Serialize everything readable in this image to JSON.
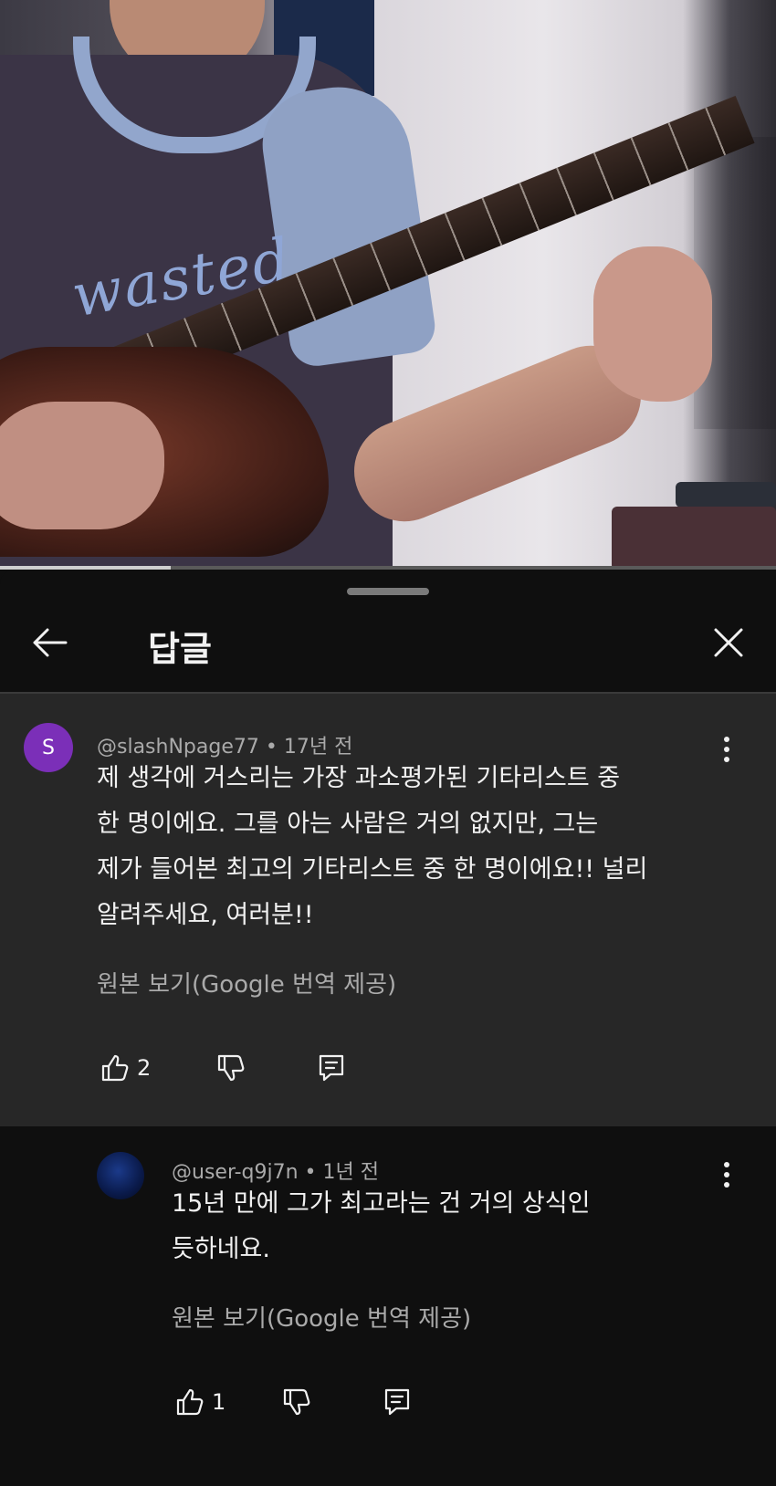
{
  "video": {
    "shirt_print": "wasted",
    "progress": 0.22
  },
  "header": {
    "title": "답글"
  },
  "comments": [
    {
      "avatar_letter": "S",
      "avatar_color": "#7b2fb8",
      "author": "@slashNpage77",
      "separator": "•",
      "time": "17년 전",
      "lines": [
        "제 생각에 거스리는 가장 과소평가된 기타리스트 중",
        "한 명이에요. 그를 아는 사람은 거의 없지만, 그는",
        "제가 들어본 최고의 기타리스트 중 한 명이에요!! 널리",
        "알려주세요, 여러분!!"
      ],
      "translate_link": "원본 보기(Google 번역 제공)",
      "likes": "2"
    },
    {
      "author": "@user-q9j7n",
      "separator": "•",
      "time": "1년 전",
      "lines": [
        "15년 만에 그가 최고라는 건 거의 상식인",
        "듯하네요."
      ],
      "translate_link": "원본 보기(Google 번역 제공)",
      "likes": "1"
    }
  ],
  "icons": {
    "back": "arrow-left-icon",
    "close": "close-icon",
    "more": "more-vertical-icon",
    "like": "thumbs-up-icon",
    "dislike": "thumbs-down-icon",
    "reply": "reply-icon"
  }
}
